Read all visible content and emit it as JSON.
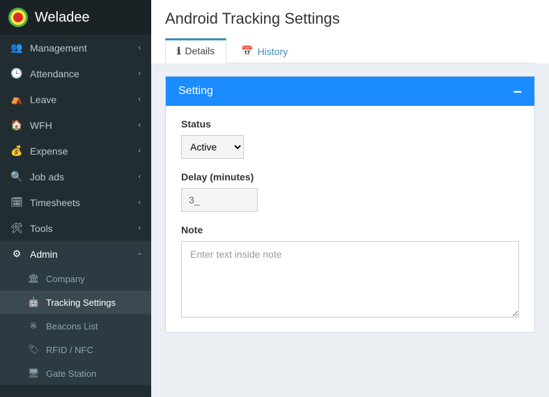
{
  "brand": {
    "name": "Weladee"
  },
  "sidebar": {
    "items": [
      {
        "label": "Management",
        "icon": "👥"
      },
      {
        "label": "Attendance",
        "icon": "🕒"
      },
      {
        "label": "Leave",
        "icon": "⛺"
      },
      {
        "label": "WFH",
        "icon": "🏠"
      },
      {
        "label": "Expense",
        "icon": "💰"
      },
      {
        "label": "Job ads",
        "icon": "🔍"
      },
      {
        "label": "Timesheets",
        "icon": "🗓"
      },
      {
        "label": "Tools",
        "icon": "🛠"
      }
    ],
    "admin": {
      "label": "Admin",
      "icon": "⚙",
      "children": [
        {
          "label": "Company",
          "icon": "🏛"
        },
        {
          "label": "Tracking Settings",
          "icon": "🤖"
        },
        {
          "label": "Beacons List",
          "icon": "※"
        },
        {
          "label": "RFID / NFC",
          "icon": "🏷"
        },
        {
          "label": "Gate Station",
          "icon": "🖥"
        }
      ]
    }
  },
  "page": {
    "title": "Android Tracking Settings"
  },
  "tabs": {
    "details": {
      "label": "Details",
      "icon": "ℹ"
    },
    "history": {
      "label": "History",
      "icon": "📅"
    }
  },
  "panel": {
    "title": "Setting",
    "collapse_icon": "–"
  },
  "form": {
    "status_label": "Status",
    "status_value": "Active",
    "delay_label": "Delay (minutes)",
    "delay_value": "3_",
    "note_label": "Note",
    "note_placeholder": "Enter text inside note"
  }
}
